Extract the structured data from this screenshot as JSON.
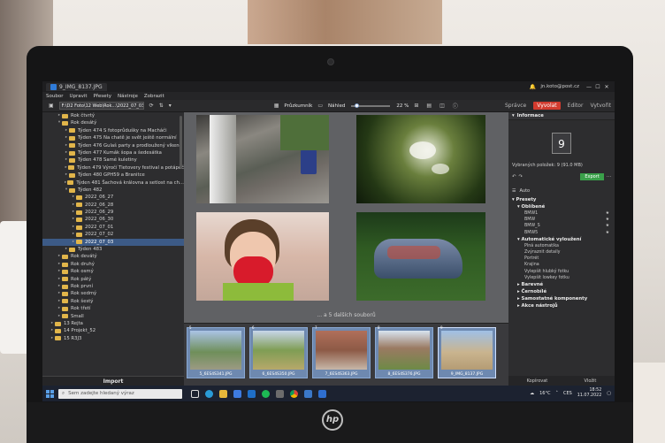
{
  "window": {
    "tab_title": "9_IMG_8137.JPG",
    "user_email": "jn.koto@post.cz",
    "controls": [
      "—",
      "☐",
      "✕"
    ]
  },
  "menu": [
    "Soubor",
    "Upravit",
    "Přesety",
    "Nástroje",
    "Zobrazit"
  ],
  "toolbar": {
    "path": "F:\\D2 Foto\\12 Web\\Rok...\\2022_07_03",
    "view_label": "Průzkumník",
    "preview_label": "Náhled",
    "zoom": "22 %"
  },
  "modes": {
    "manager": "Správce",
    "develop": "Vyvolat",
    "editor": "Editor",
    "export": "Vytvořit"
  },
  "tree": {
    "items": [
      {
        "label": "Rok čtvrtý",
        "indent": 2,
        "arrow": "▸"
      },
      {
        "label": "Rok desátý",
        "indent": 2,
        "arrow": "▾"
      },
      {
        "label": "Týden 474 S fotoprůdušky na Macháči",
        "indent": 3,
        "arrow": "▸"
      },
      {
        "label": "Týden 475 Na chatě je svět ještě normální",
        "indent": 3,
        "arrow": "▸"
      },
      {
        "label": "Týden 476 Gulaš party a prodloužený víkend",
        "indent": 3,
        "arrow": "▸"
      },
      {
        "label": "Týden 477 Kumák šopa a šedesátka",
        "indent": 3,
        "arrow": "▸"
      },
      {
        "label": "Týden 478 Samé kuletiny",
        "indent": 3,
        "arrow": "▸"
      },
      {
        "label": "Týden 479 Výročí Tietovery festival a potápěč",
        "indent": 3,
        "arrow": "▸"
      },
      {
        "label": "Týden 480 GPH59 a Branitce",
        "indent": 3,
        "arrow": "▸"
      },
      {
        "label": "Týden 481 Šachová královna a setlost na ch...",
        "indent": 3,
        "arrow": "▸"
      },
      {
        "label": "Týden 482",
        "indent": 3,
        "arrow": "▾"
      },
      {
        "label": "2022_06_27",
        "indent": 4,
        "arrow": "▸"
      },
      {
        "label": "2022_06_28",
        "indent": 4,
        "arrow": "▸"
      },
      {
        "label": "2022_06_29",
        "indent": 4,
        "arrow": "▸"
      },
      {
        "label": "2022_06_30",
        "indent": 4,
        "arrow": "▸"
      },
      {
        "label": "2022_07_01",
        "indent": 4,
        "arrow": "▸"
      },
      {
        "label": "2022_07_02",
        "indent": 4,
        "arrow": "▸"
      },
      {
        "label": "2022_07_03",
        "indent": 4,
        "arrow": "▸",
        "selected": true
      },
      {
        "label": "Týden 483",
        "indent": 3,
        "arrow": "▸"
      },
      {
        "label": "Rok devátý",
        "indent": 2,
        "arrow": "▸"
      },
      {
        "label": "Rok druhý",
        "indent": 2,
        "arrow": "▸"
      },
      {
        "label": "Rok osmý",
        "indent": 2,
        "arrow": "▸"
      },
      {
        "label": "Rok pátý",
        "indent": 2,
        "arrow": "▸"
      },
      {
        "label": "Rok první",
        "indent": 2,
        "arrow": "▸"
      },
      {
        "label": "Rok sedmý",
        "indent": 2,
        "arrow": "▸"
      },
      {
        "label": "Rok šestý",
        "indent": 2,
        "arrow": "▸"
      },
      {
        "label": "Rok třetí",
        "indent": 2,
        "arrow": "▸"
      },
      {
        "label": "Small",
        "indent": 2,
        "arrow": "▸"
      },
      {
        "label": "13 Rejta",
        "indent": 1,
        "arrow": "▸"
      },
      {
        "label": "14 Projekt_52",
        "indent": 1,
        "arrow": "▸"
      },
      {
        "label": "15 R3J3",
        "indent": 1,
        "arrow": "▸"
      }
    ],
    "import_label": "Import"
  },
  "preview": {
    "more_files": "... a 5 dalších souborů"
  },
  "filmstrip": [
    {
      "caption": "5_6ES4S341.JPG",
      "badge": "5"
    },
    {
      "caption": "6_6ES4S350.JPG",
      "badge": "6"
    },
    {
      "caption": "7_6ES4S363.JPG",
      "badge": "7"
    },
    {
      "caption": "8_6ES4S376.JPG",
      "badge": "8"
    },
    {
      "caption": "9_IMG_8137.JPG",
      "badge": "9"
    }
  ],
  "info_panel": {
    "title": "Informace",
    "count": "9",
    "selection": "Vybraných položek: 9 (91.0 MB)",
    "export_label": "Export",
    "auto_label": "Auto"
  },
  "presets": {
    "title": "Presety",
    "favorites_label": "Oblíbené",
    "favorites": [
      "BMW1",
      "BMW",
      "BMW_S",
      "BMW5"
    ],
    "auto_label": "Automatické vyloužení",
    "auto_items": [
      "Plná automatika",
      "Zvýraznit detaily",
      "Portrét",
      "Krajina",
      "Vylepšit hlubký fotku",
      "Vylepšit lowkey fotku"
    ],
    "sections": [
      "Barevné",
      "Černobílé",
      "Samostatné komponenty",
      "Akce nástrojů"
    ]
  },
  "right_footer": {
    "left": "Kopírovat",
    "right": "Vložit"
  },
  "taskbar": {
    "search_placeholder": "Sem zadejte hledaný výraz",
    "temperature": "16°C",
    "language": "CES",
    "time": "18:52",
    "date": "11.07.2022"
  }
}
